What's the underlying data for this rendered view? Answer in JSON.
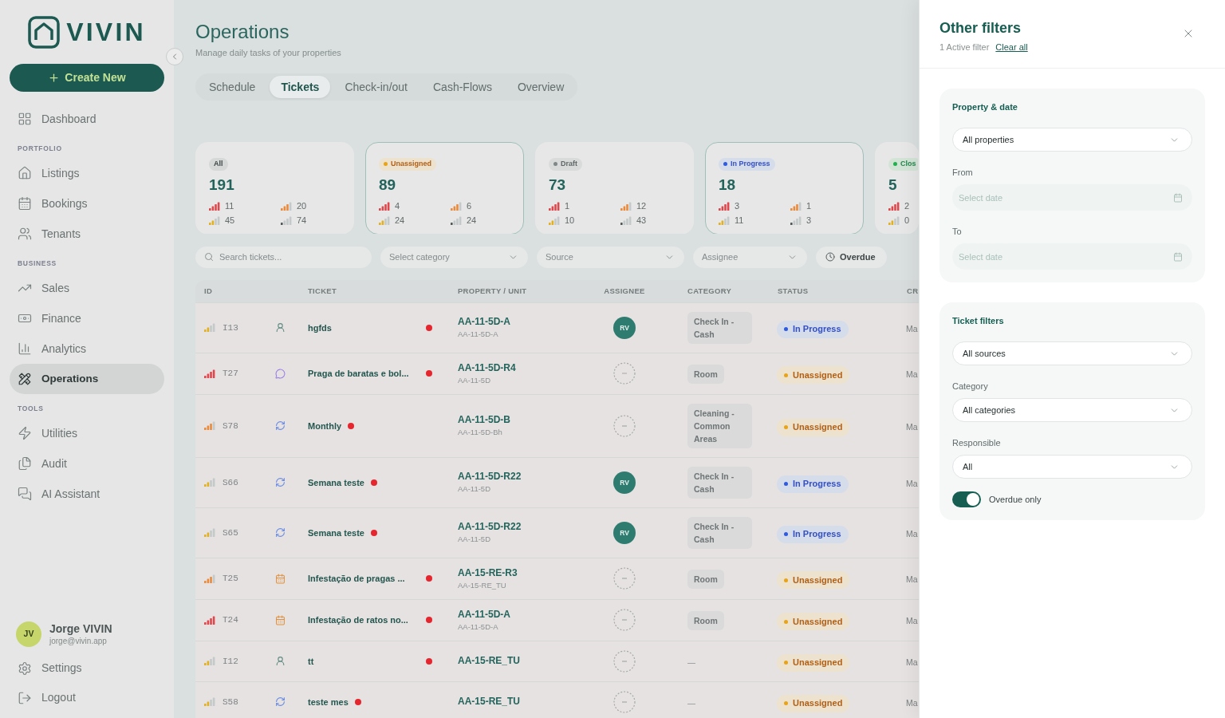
{
  "sidebar": {
    "logo": "VIVIN",
    "create_button": "Create New",
    "nav": [
      {
        "items": [
          {
            "label": "Dashboard",
            "selected": false
          }
        ]
      },
      {
        "heading": "PORTFOLIO",
        "items": [
          {
            "label": "Listings",
            "selected": false
          },
          {
            "label": "Bookings",
            "selected": false
          },
          {
            "label": "Tenants",
            "selected": false
          }
        ]
      },
      {
        "heading": "BUSINESS",
        "items": [
          {
            "label": "Sales",
            "selected": false
          },
          {
            "label": "Finance",
            "selected": false
          },
          {
            "label": "Analytics",
            "selected": false
          },
          {
            "label": "Operations",
            "selected": true
          }
        ]
      },
      {
        "heading": "TOOLS",
        "items": [
          {
            "label": "Utilities",
            "selected": false
          },
          {
            "label": "Audit",
            "selected": false
          },
          {
            "label": "AI Assistant",
            "selected": false
          }
        ]
      }
    ],
    "user": {
      "initials": "JV",
      "name": "Jorge VIVIN",
      "email": "jorge@vivin.app"
    },
    "footer": [
      {
        "label": "Settings"
      },
      {
        "label": "Logout"
      }
    ]
  },
  "header": {
    "title": "Operations",
    "subtitle": "Manage daily tasks of your properties"
  },
  "tabs": [
    {
      "label": "Schedule",
      "selected": false
    },
    {
      "label": "Tickets",
      "selected": true
    },
    {
      "label": "Check-in/out",
      "selected": false
    },
    {
      "label": "Cash-Flows",
      "selected": false
    },
    {
      "label": "Overview",
      "selected": false
    }
  ],
  "status_cards": [
    {
      "kind": "all",
      "label": "All",
      "count": "191",
      "selected": false,
      "priority_rows": [
        [
          {
            "kind": "urgent",
            "count": "11"
          },
          {
            "kind": "high",
            "count": "20"
          }
        ],
        [
          {
            "kind": "medium",
            "count": "45"
          },
          {
            "kind": "low",
            "count": "74"
          }
        ]
      ]
    },
    {
      "kind": "unassigned",
      "label": "Unassigned",
      "count": "89",
      "selected": true,
      "priority_rows": [
        [
          {
            "kind": "urgent",
            "count": "4"
          },
          {
            "kind": "high",
            "count": "6"
          }
        ],
        [
          {
            "kind": "medium",
            "count": "24"
          },
          {
            "kind": "low",
            "count": "24"
          }
        ]
      ]
    },
    {
      "kind": "draft",
      "label": "Draft",
      "count": "73",
      "selected": false,
      "priority_rows": [
        [
          {
            "kind": "urgent",
            "count": "1"
          },
          {
            "kind": "high",
            "count": "12"
          }
        ],
        [
          {
            "kind": "medium",
            "count": "10"
          },
          {
            "kind": "low",
            "count": "43"
          }
        ]
      ]
    },
    {
      "kind": "in_progress",
      "label": "In Progress",
      "count": "18",
      "selected": true,
      "priority_rows": [
        [
          {
            "kind": "urgent",
            "count": "3"
          },
          {
            "kind": "high",
            "count": "1"
          }
        ],
        [
          {
            "kind": "medium",
            "count": "11"
          },
          {
            "kind": "low",
            "count": "3"
          }
        ]
      ]
    },
    {
      "kind": "closed",
      "label": "Clos",
      "count": "5",
      "selected": false,
      "priority_rows": [
        [
          {
            "kind": "urgent",
            "count": "2"
          }
        ],
        [
          {
            "kind": "medium",
            "count": "0"
          }
        ]
      ]
    }
  ],
  "filters": {
    "search": {
      "placeholder": "Search tickets..."
    },
    "selects": [
      {
        "placeholder": "Select category"
      },
      {
        "placeholder": "Source"
      },
      {
        "placeholder": "Assignee"
      }
    ],
    "overdue_button": "Overdue"
  },
  "table": {
    "columns": [
      "ID",
      "TICKET",
      "PROPERTY / UNIT",
      "ASSIGNEE",
      "CATEGORY",
      "STATUS",
      "CR"
    ],
    "rows": [
      {
        "priority": {
          "kind": "medium"
        },
        "id": "I13",
        "source": {
          "kind": "person"
        },
        "title": "hgfds",
        "overdue": true,
        "property": "AA-11-5D-A",
        "unit": "AA-11-5D-A",
        "assignee": "RV",
        "category": "Check In - Cash",
        "status": {
          "kind": "in_progress",
          "label": "In Progress"
        },
        "created": "Ma"
      },
      {
        "priority": {
          "kind": "urgent"
        },
        "id": "T27",
        "source": {
          "kind": "chat"
        },
        "title": "Praga de baratas e bol...",
        "overdue": true,
        "property": "AA-11-5D-R4",
        "unit": "AA-11-5D",
        "category": "Room",
        "status": {
          "kind": "unassigned",
          "label": "Unassigned"
        },
        "created": "Ma"
      },
      {
        "priority": {
          "kind": "high"
        },
        "id": "S78",
        "source": {
          "kind": "recurring"
        },
        "title": "Monthly",
        "overdue": true,
        "property": "AA-11-5D-B",
        "unit": "AA-11-5D-Bh",
        "category": "Cleaning - Common Areas",
        "status": {
          "kind": "unassigned",
          "label": "Unassigned"
        },
        "created": "Ma"
      },
      {
        "priority": {
          "kind": "medium"
        },
        "id": "S66",
        "source": {
          "kind": "recurring"
        },
        "title": "Semana teste",
        "overdue": true,
        "property": "AA-11-5D-R22",
        "unit": "AA-11-5D",
        "assignee": "RV",
        "category": "Check In - Cash",
        "status": {
          "kind": "in_progress",
          "label": "In Progress"
        },
        "created": "Ma"
      },
      {
        "priority": {
          "kind": "medium"
        },
        "id": "S65",
        "source": {
          "kind": "recurring"
        },
        "title": "Semana teste",
        "overdue": true,
        "property": "AA-11-5D-R22",
        "unit": "AA-11-5D",
        "assignee": "RV",
        "category": "Check In - Cash",
        "status": {
          "kind": "in_progress",
          "label": "In Progress"
        },
        "created": "Ma"
      },
      {
        "priority": {
          "kind": "high"
        },
        "id": "T25",
        "source": {
          "kind": "booking"
        },
        "title": "Infestação de pragas ...",
        "overdue": true,
        "property": "AA-15-RE-R3",
        "unit": "AA-15-RE_TU",
        "category": "Room",
        "status": {
          "kind": "unassigned",
          "label": "Unassigned"
        },
        "created": "Ma"
      },
      {
        "priority": {
          "kind": "urgent"
        },
        "id": "T24",
        "source": {
          "kind": "booking"
        },
        "title": "Infestação de ratos no...",
        "overdue": true,
        "property": "AA-11-5D-A",
        "unit": "AA-11-5D-A",
        "category": "Room",
        "status": {
          "kind": "unassigned",
          "label": "Unassigned"
        },
        "created": "Ma"
      },
      {
        "priority": {
          "kind": "medium"
        },
        "id": "I12",
        "source": {
          "kind": "person"
        },
        "title": "tt",
        "overdue": true,
        "property": "AA-15-RE_TU",
        "category_blank": "—",
        "status": {
          "kind": "unassigned",
          "label": "Unassigned"
        },
        "created": "Ma"
      },
      {
        "priority": {
          "kind": "medium"
        },
        "id": "S58",
        "source": {
          "kind": "recurring"
        },
        "title": "teste mes",
        "overdue": true,
        "property": "AA-15-RE_TU",
        "category_blank": "—",
        "status": {
          "kind": "unassigned",
          "label": "Unassigned"
        },
        "created": "Ma"
      }
    ]
  },
  "drawer": {
    "title": "Other filters",
    "active_count": "1 Active filter",
    "clear_link": "Clear all",
    "sections": [
      {
        "title": "Property & date",
        "fields": [
          {
            "kind": "select",
            "value": "All properties"
          },
          {
            "kind": "date",
            "label": "From",
            "placeholder": "Select date"
          },
          {
            "kind": "date",
            "label": "To",
            "placeholder": "Select date"
          }
        ]
      },
      {
        "title": "Ticket filters",
        "fields": [
          {
            "kind": "select",
            "value": "All sources"
          },
          {
            "kind": "select",
            "label": "Category",
            "value": "All categories"
          },
          {
            "kind": "select",
            "label": "Responsible",
            "value": "All"
          },
          {
            "kind": "toggle",
            "label": "Overdue only",
            "on": true
          }
        ]
      }
    ]
  }
}
